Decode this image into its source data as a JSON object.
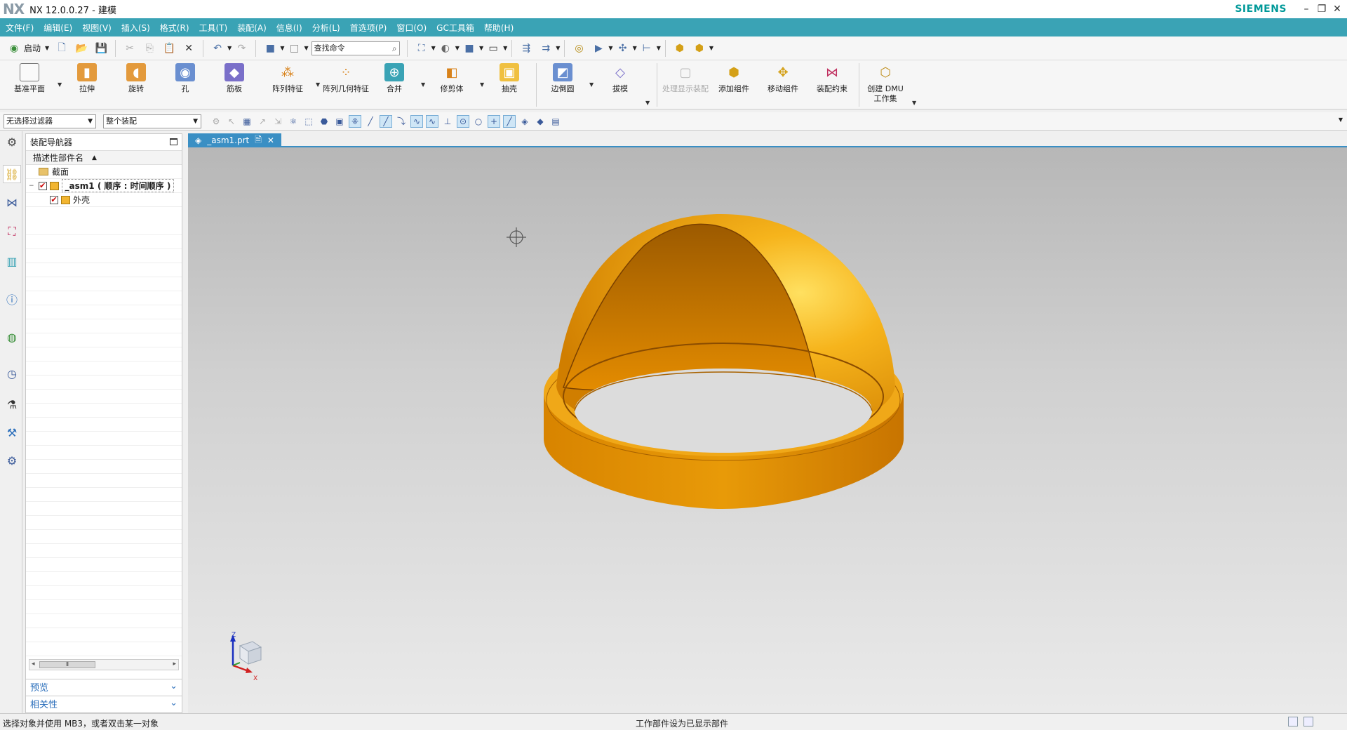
{
  "app": {
    "logo": "NX",
    "title": "NX 12.0.0.27 - 建模",
    "brand": "SIEMENS"
  },
  "menu": [
    "文件(F)",
    "编辑(E)",
    "视图(V)",
    "插入(S)",
    "格式(R)",
    "工具(T)",
    "装配(A)",
    "信息(I)",
    "分析(L)",
    "首选项(P)",
    "窗口(O)",
    "GC工具箱",
    "帮助(H)"
  ],
  "quick": {
    "start_label": "启动",
    "search_placeholder": "查找命令"
  },
  "ribbon": {
    "datum_plane": "基准平面",
    "extrude": "拉伸",
    "revolve": "旋转",
    "hole": "孔",
    "rib": "筋板",
    "pattern_feature": "阵列特征",
    "pattern_geometry": "阵列几何特征",
    "unite": "合并",
    "trim_body": "修剪体",
    "shell": "抽壳",
    "edge_blend": "边倒圆",
    "draft": "拔模",
    "show_hide_assembly": "处理显示装配",
    "add_component": "添加组件",
    "move_component": "移动组件",
    "assembly_constraints": "装配约束",
    "create_dmu": "创建 DMU 工作集"
  },
  "selection": {
    "filter": "无选择过滤器",
    "scope": "整个装配"
  },
  "navigator": {
    "title": "装配导航器",
    "column": "描述性部件名",
    "rows": [
      {
        "label": "截面"
      },
      {
        "label": "_asm1 ( 顺序 : 时间顺序 )"
      },
      {
        "label": "外壳"
      }
    ],
    "sections": [
      "预览",
      "相关性"
    ]
  },
  "tab": {
    "file": "_asm1.prt"
  },
  "triad": {
    "z": "Z",
    "x": "X"
  },
  "status": {
    "left": "选择对象并使用 MB3，或者双击某一对象",
    "center": "工作部件设为已显示部件"
  },
  "colors": {
    "menubar": "#3aa3b5",
    "tab_active": "#3a8fc4",
    "model_body": "#f0a010",
    "brand": "#009999"
  }
}
